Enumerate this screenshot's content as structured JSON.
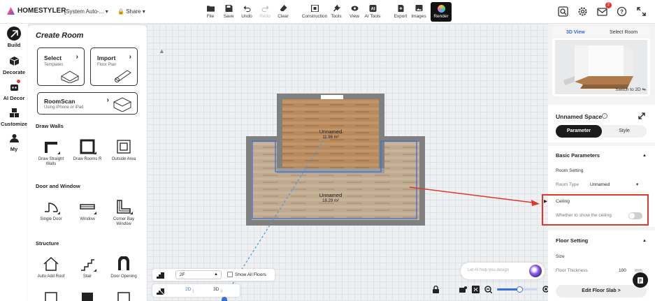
{
  "app": {
    "brand": "HOMESTYLER",
    "project": "[System Auto-...",
    "share": "Share"
  },
  "toolbar": {
    "items": [
      {
        "label": "File",
        "icon": "folder-icon"
      },
      {
        "label": "Save",
        "icon": "save-icon"
      },
      {
        "label": "Undo",
        "icon": "undo-icon"
      },
      {
        "label": "Redo",
        "icon": "redo-icon",
        "disabled": true
      },
      {
        "label": "Clear",
        "icon": "eraser-icon"
      },
      {
        "label": "Construction",
        "icon": "construction-icon"
      },
      {
        "label": "Tools",
        "icon": "tools-icon"
      },
      {
        "label": "View",
        "icon": "eye-icon"
      },
      {
        "label": "AI Tools",
        "icon": "ai-icon"
      },
      {
        "label": "Export",
        "icon": "export-icon"
      },
      {
        "label": "Images",
        "icon": "images-icon"
      }
    ],
    "render": "Render",
    "notification_count": "2"
  },
  "rail": [
    {
      "label": "Build",
      "icon": "build-icon",
      "active": true
    },
    {
      "label": "Decorate",
      "icon": "cube-icon"
    },
    {
      "label": "AI Decor",
      "icon": "robot-icon"
    },
    {
      "label": "Customize",
      "icon": "blocks-icon"
    },
    {
      "label": "My",
      "icon": "user-icon"
    }
  ],
  "create_room": {
    "title": "Create Room",
    "cards": [
      {
        "title": "Select",
        "subtitle": "Templates"
      },
      {
        "title": "Import",
        "subtitle": "Floor Plan"
      },
      {
        "title": "RoomScan",
        "subtitle": "Using iPhone or iPad"
      }
    ],
    "sections": [
      {
        "title": "Draw Walls",
        "items": [
          "Draw Straight Walls",
          "Draw Rooms R",
          "Outside Area"
        ]
      },
      {
        "title": "Door and Window",
        "items": [
          "Single Door",
          "Window",
          "Corner Bay Window"
        ]
      },
      {
        "title": "Structure",
        "items": [
          "Auto Add Roof",
          "Stair",
          "Door Opening"
        ]
      }
    ]
  },
  "canvas": {
    "rooms": [
      {
        "name": "Unnamed",
        "area": "11.96 m²"
      },
      {
        "name": "Unnamed",
        "area": "18.29 m²"
      }
    ],
    "floor_select": "2F",
    "show_all_floors": "Show All Floors",
    "view_2d": "2D",
    "view_2d_key": "1",
    "view_3d": "3D",
    "view_3d_key": "3",
    "ai_placeholder": "Let AI help you design",
    "zoom_level": 0.55
  },
  "right_panel": {
    "view_tabs": [
      "3D View",
      "Select Room"
    ],
    "switch_to_2d": "Switch to 2D",
    "space_title": "Unnamed Space",
    "tabs": [
      "Parameter",
      "Style"
    ],
    "basic_parameters": "Basic Parameters",
    "room_setting": "Room Setting",
    "room_type_label": "Room Type",
    "room_type_value": "Unnamed",
    "ceiling": "Ceiling",
    "ceiling_desc": "Whether to show the ceiling",
    "ceiling_on": false,
    "floor_setting": "Floor Setting",
    "size": "Size",
    "floor_thickness_label": "Floor Thickness",
    "floor_thickness_value": "100",
    "floor_thickness_unit": "mm",
    "edit_floor_slab": "Edit Floor Slab >"
  },
  "colors": {
    "accent": "#3b6fd8",
    "highlight": "#d93a2b",
    "dark": "#1b1b1b"
  }
}
